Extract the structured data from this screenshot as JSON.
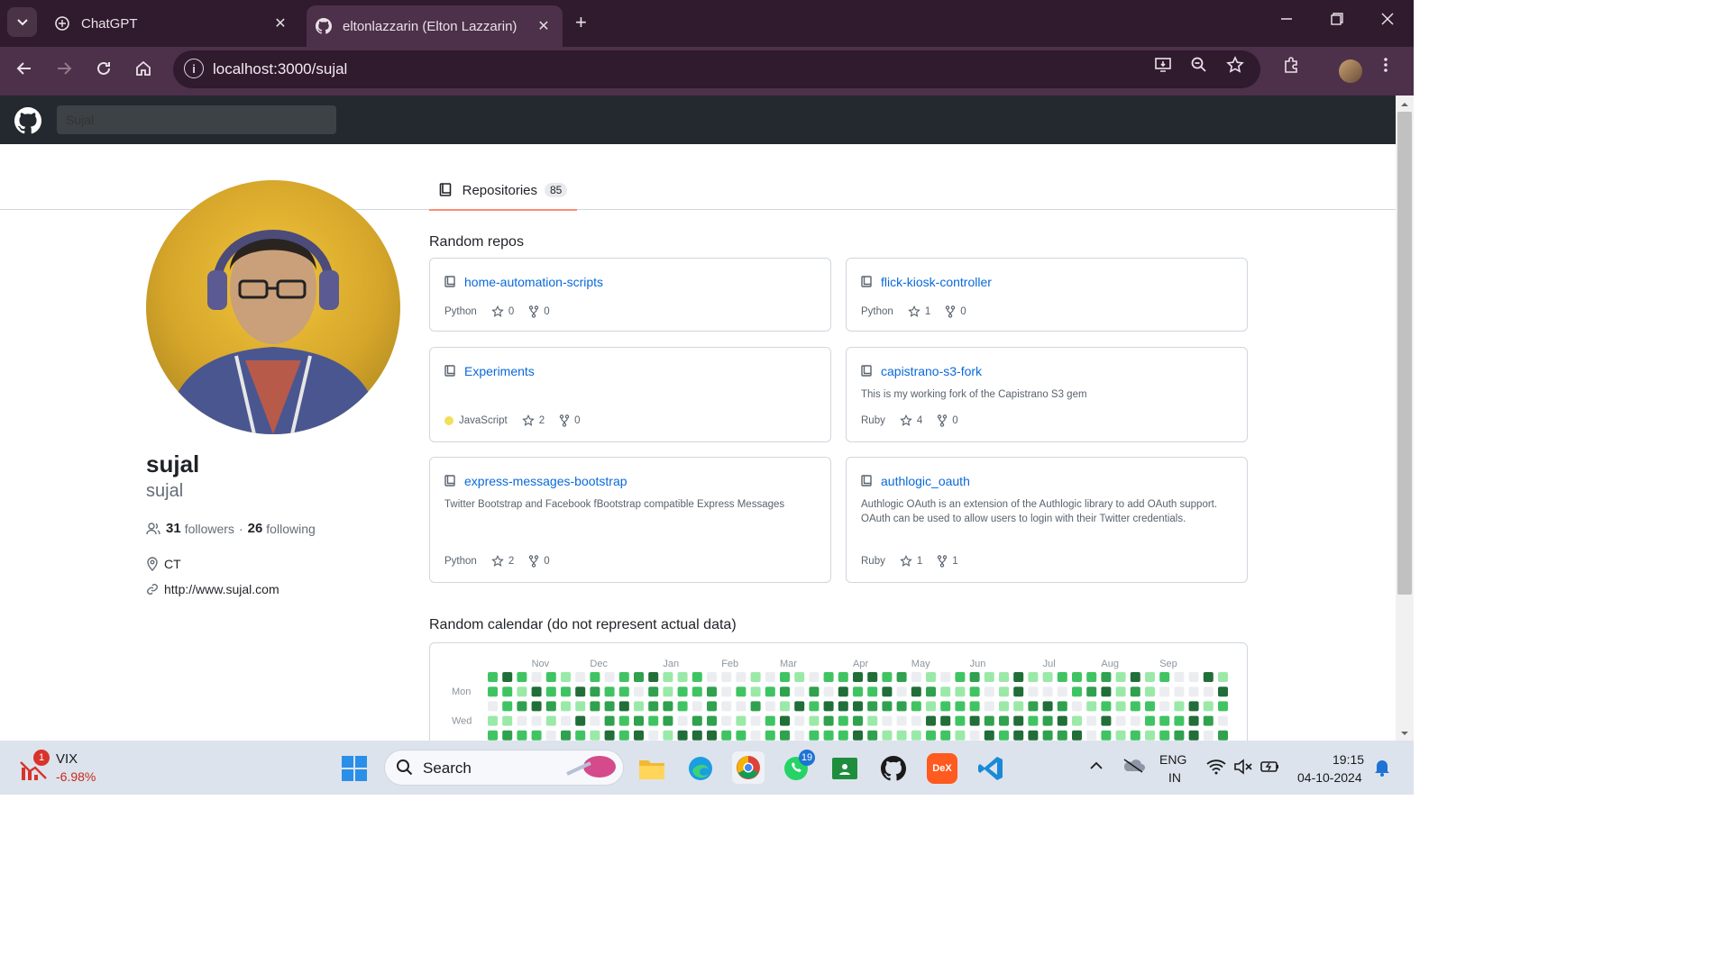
{
  "browser": {
    "tabs": [
      {
        "title": "ChatGPT",
        "close": "✕"
      },
      {
        "title": "eltonlazzarin (Elton Lazzarin)",
        "close": "✕"
      }
    ],
    "new_tab": "+",
    "url": "localhost:3000/sujal",
    "info_icon": "i"
  },
  "header": {
    "search_value": "Sujal"
  },
  "tabs": {
    "repositories_label": "Repositories",
    "repositories_count": "85"
  },
  "profile": {
    "name": "sujal",
    "login": "sujal",
    "followers_count": "31",
    "followers_label": "followers",
    "separator": "·",
    "following_count": "26",
    "following_label": "following",
    "location": "CT",
    "website": "http://www.sujal.com"
  },
  "repos_section": {
    "title": "Random repos",
    "repos": [
      {
        "name": "home-automation-scripts",
        "description": "",
        "language": "Python",
        "stars": "0",
        "forks": "0"
      },
      {
        "name": "flick-kiosk-controller",
        "description": "",
        "language": "Python",
        "stars": "1",
        "forks": "0"
      },
      {
        "name": "Experiments",
        "description": "",
        "language": "JavaScript",
        "stars": "2",
        "forks": "0"
      },
      {
        "name": "capistrano-s3-fork",
        "description": "This is my working fork of the Capistrano S3 gem",
        "language": "Ruby",
        "stars": "4",
        "forks": "0"
      },
      {
        "name": "express-messages-bootstrap",
        "description": "Twitter Bootstrap and Facebook fBootstrap compatible Express Messages",
        "language": "Python",
        "stars": "2",
        "forks": "0"
      },
      {
        "name": "authlogic_oauth",
        "description": "Authlogic OAuth is an extension of the Authlogic library to add OAuth support. OAuth can be used to allow users to login with their Twitter credentials.",
        "language": "Ruby",
        "stars": "1",
        "forks": "1"
      }
    ]
  },
  "calendar": {
    "title": "Random calendar (do not represent actual data)",
    "months": [
      "Nov",
      "Dec",
      "Jan",
      "Feb",
      "Mar",
      "Apr",
      "May",
      "Jun",
      "Jul",
      "Aug",
      "Sep"
    ],
    "day_labels": [
      "Mon",
      "Wed"
    ],
    "colors": [
      "#ebedf0",
      "#9be9a8",
      "#40c463",
      "#30a14e",
      "#216e39"
    ]
  },
  "taskbar": {
    "ticker_name": "VIX",
    "ticker_change": "-6.98%",
    "ticker_badge": "1",
    "search_label": "Search",
    "whatsapp_badge": "19",
    "language_top": "ENG",
    "language_bottom": "IN",
    "time": "19:15",
    "date": "04-10-2024",
    "dex_label": "DeX"
  }
}
